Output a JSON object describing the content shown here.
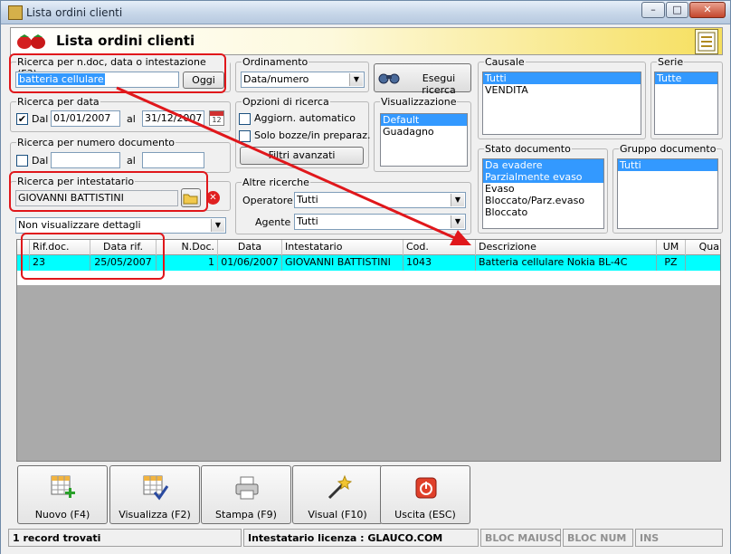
{
  "window": {
    "title": "Lista ordini clienti",
    "minimize": "–",
    "maximize": "□",
    "close": "✕"
  },
  "header": {
    "title": "Lista ordini clienti"
  },
  "search_doc": {
    "label": "Ricerca per n.doc, data o intestazione (F3)",
    "value": "batteria cellulare",
    "today_button": "Oggi"
  },
  "ordering": {
    "label": "Ordinamento",
    "value": "Data/numero"
  },
  "run_search": {
    "label": "Esegui ricerca"
  },
  "causale": {
    "label": "Causale",
    "items": [
      "Tutti",
      "VENDITA"
    ]
  },
  "serie": {
    "label": "Serie",
    "items": [
      "Tutte"
    ]
  },
  "search_date": {
    "label": "Ricerca per data",
    "from_label": "Dal",
    "from_value": "01/01/2007",
    "to_label": "al",
    "to_value": "31/12/2007"
  },
  "options": {
    "label": "Opzioni di ricerca",
    "auto_update": "Aggiorn. automatico",
    "drafts_only": "Solo bozze/in preparaz.",
    "advanced_filters": "Filtri avanzati"
  },
  "visualization": {
    "label": "Visualizzazione",
    "items": [
      "Default",
      "Guadagno"
    ]
  },
  "search_number": {
    "label": "Ricerca per numero documento",
    "from_label": "Dal",
    "to_label": "al"
  },
  "doc_status": {
    "label": "Stato documento",
    "items": [
      "Da evadere",
      "Parzialmente evaso",
      "Evaso",
      "Bloccato/Parz.evaso",
      "Bloccato"
    ]
  },
  "doc_group": {
    "label": "Gruppo documento",
    "items": [
      "Tutti"
    ]
  },
  "search_holder": {
    "label": "Ricerca per intestatario",
    "value": "GIOVANNI BATTISTINI"
  },
  "other_searches": {
    "label": "Altre ricerche",
    "operator_label": "Operatore :",
    "operator_value": "Tutti",
    "agent_label": "Agente :",
    "agent_value": "Tutti"
  },
  "details_select": {
    "value": "Non visualizzare dettagli"
  },
  "grid": {
    "columns": [
      "Rif.doc.",
      "Data rif.",
      "N.Doc.",
      "Data",
      "Intestatario",
      "Cod.",
      "Descrizione",
      "UM",
      "Qua"
    ],
    "rows": [
      [
        "23",
        "25/05/2007",
        "1",
        "01/06/2007",
        "GIOVANNI BATTISTINI",
        "1043",
        "Batteria cellulare Nokia BL-4C",
        "PZ",
        ""
      ]
    ]
  },
  "actions": [
    {
      "label": "Nuovo (F4)",
      "icon": "new-grid-icon"
    },
    {
      "label": "Visualizza (F2)",
      "icon": "view-grid-icon"
    },
    {
      "label": "Stampa (F9)",
      "icon": "printer-icon"
    },
    {
      "label": "Visual (F10)",
      "icon": "magic-wand-icon"
    },
    {
      "label": "Uscita (ESC)",
      "icon": "exit-icon"
    }
  ],
  "status": {
    "records": "1 record trovati",
    "license": "Intestatario licenza : GLAUCO.COM",
    "caps": "BLOC MAIUSC",
    "num": "BLOC NUM",
    "ins": "INS"
  },
  "colors": {
    "selection": "#3399ff",
    "row_highlight": "#00ffff",
    "annotation": "#e0171b",
    "header_gradient_end": "#f6df5e"
  }
}
